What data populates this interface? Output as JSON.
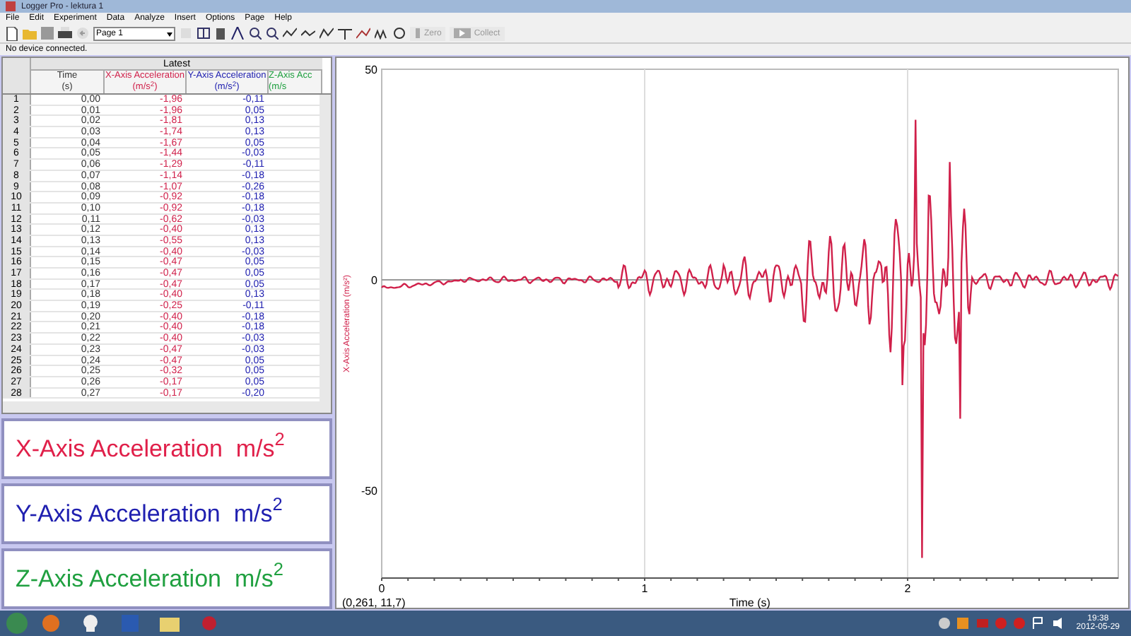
{
  "window": {
    "title": "Logger Pro - lektura 1"
  },
  "menu": [
    "File",
    "Edit",
    "Experiment",
    "Data",
    "Analyze",
    "Insert",
    "Options",
    "Page",
    "Help"
  ],
  "toolbar": {
    "page_select": "Page 1",
    "zero_button": {
      "label": "Zero",
      "disabled": true
    },
    "collect_button": {
      "label": "Collect",
      "disabled": true
    }
  },
  "status": "No device connected.",
  "table": {
    "group_header": "Latest",
    "columns": [
      {
        "name": "Time",
        "unit": "(s)",
        "color": "#333333"
      },
      {
        "name": "X-Axis Acceleration",
        "unit": "(m/s$^{2}$)",
        "color": "#d0204a"
      },
      {
        "name": "Y-Axis Acceleration",
        "unit": "(m/s$^{2}$)",
        "color": "#2020b0"
      },
      {
        "name": "Z-Axis Acc",
        "unit": "(m/s",
        "color": "#20a040"
      }
    ],
    "rows": [
      {
        "number": "1",
        "cells": [
          "0,00",
          "-1,96",
          "-0,11"
        ]
      },
      {
        "number": "2",
        "cells": [
          "0,01",
          "-1,96",
          "0,05"
        ]
      },
      {
        "number": "3",
        "cells": [
          "0,02",
          "-1,81",
          "0,13"
        ]
      },
      {
        "number": "4",
        "cells": [
          "0,03",
          "-1,74",
          "0,13"
        ]
      },
      {
        "number": "5",
        "cells": [
          "0,04",
          "-1,67",
          "0,05"
        ]
      },
      {
        "number": "6",
        "cells": [
          "0,05",
          "-1,44",
          "-0,03"
        ]
      },
      {
        "number": "7",
        "cells": [
          "0,06",
          "-1,29",
          "-0,11"
        ]
      },
      {
        "number": "8",
        "cells": [
          "0,07",
          "-1,14",
          "-0,18"
        ]
      },
      {
        "number": "9",
        "cells": [
          "0,08",
          "-1,07",
          "-0,26"
        ]
      },
      {
        "number": "10",
        "cells": [
          "0,09",
          "-0,92",
          "-0,18"
        ]
      },
      {
        "number": "11",
        "cells": [
          "0,10",
          "-0,92",
          "-0,18"
        ]
      },
      {
        "number": "12",
        "cells": [
          "0,11",
          "-0,62",
          "-0,03"
        ]
      },
      {
        "number": "13",
        "cells": [
          "0,12",
          "-0,40",
          "0,13"
        ]
      },
      {
        "number": "14",
        "cells": [
          "0,13",
          "-0,55",
          "0,13"
        ]
      },
      {
        "number": "15",
        "cells": [
          "0,14",
          "-0,40",
          "-0,03"
        ]
      },
      {
        "number": "16",
        "cells": [
          "0,15",
          "-0,47",
          "0,05"
        ]
      },
      {
        "number": "17",
        "cells": [
          "0,16",
          "-0,47",
          "0,05"
        ]
      },
      {
        "number": "18",
        "cells": [
          "0,17",
          "-0,47",
          "0,05"
        ]
      },
      {
        "number": "19",
        "cells": [
          "0,18",
          "-0,40",
          "0,13"
        ]
      },
      {
        "number": "20",
        "cells": [
          "0,19",
          "-0,25",
          "-0,11"
        ]
      },
      {
        "number": "21",
        "cells": [
          "0,20",
          "-0,40",
          "-0,18"
        ]
      },
      {
        "number": "22",
        "cells": [
          "0,21",
          "-0,40",
          "-0,18"
        ]
      },
      {
        "number": "23",
        "cells": [
          "0,22",
          "-0,40",
          "-0,03"
        ]
      },
      {
        "number": "24",
        "cells": [
          "0,23",
          "-0,47",
          "-0,03"
        ]
      },
      {
        "number": "25",
        "cells": [
          "0,24",
          "-0,47",
          "0,05"
        ]
      },
      {
        "number": "26",
        "cells": [
          "0,25",
          "-0,32",
          "0,05"
        ]
      },
      {
        "number": "27",
        "cells": [
          "0,26",
          "-0,17",
          "0,05"
        ]
      },
      {
        "number": "28",
        "cells": [
          "0,27",
          "-0,17",
          "-0,20"
        ]
      }
    ]
  },
  "meters": [
    {
      "label": "X-Axis Acceleration  m/s$^{2}$",
      "color": "#e0204a"
    },
    {
      "label": "Y-Axis Acceleration  m/s$^{2}$",
      "color": "#2020b0"
    },
    {
      "label": "Z-Axis Acceleration  m/s$^{2}$",
      "color": "#20a040"
    }
  ],
  "graph": {
    "ylabel": "X-Axis Acceleration (m/s²)",
    "xlabel": "Time (s)",
    "yticks": [
      "50",
      "0",
      "-50"
    ],
    "xticks": [
      "0",
      "1",
      "2"
    ],
    "readout": "(0,261, 11,7)"
  },
  "taskbar": {
    "time": "19:38",
    "date": "2012-05-29"
  }
}
